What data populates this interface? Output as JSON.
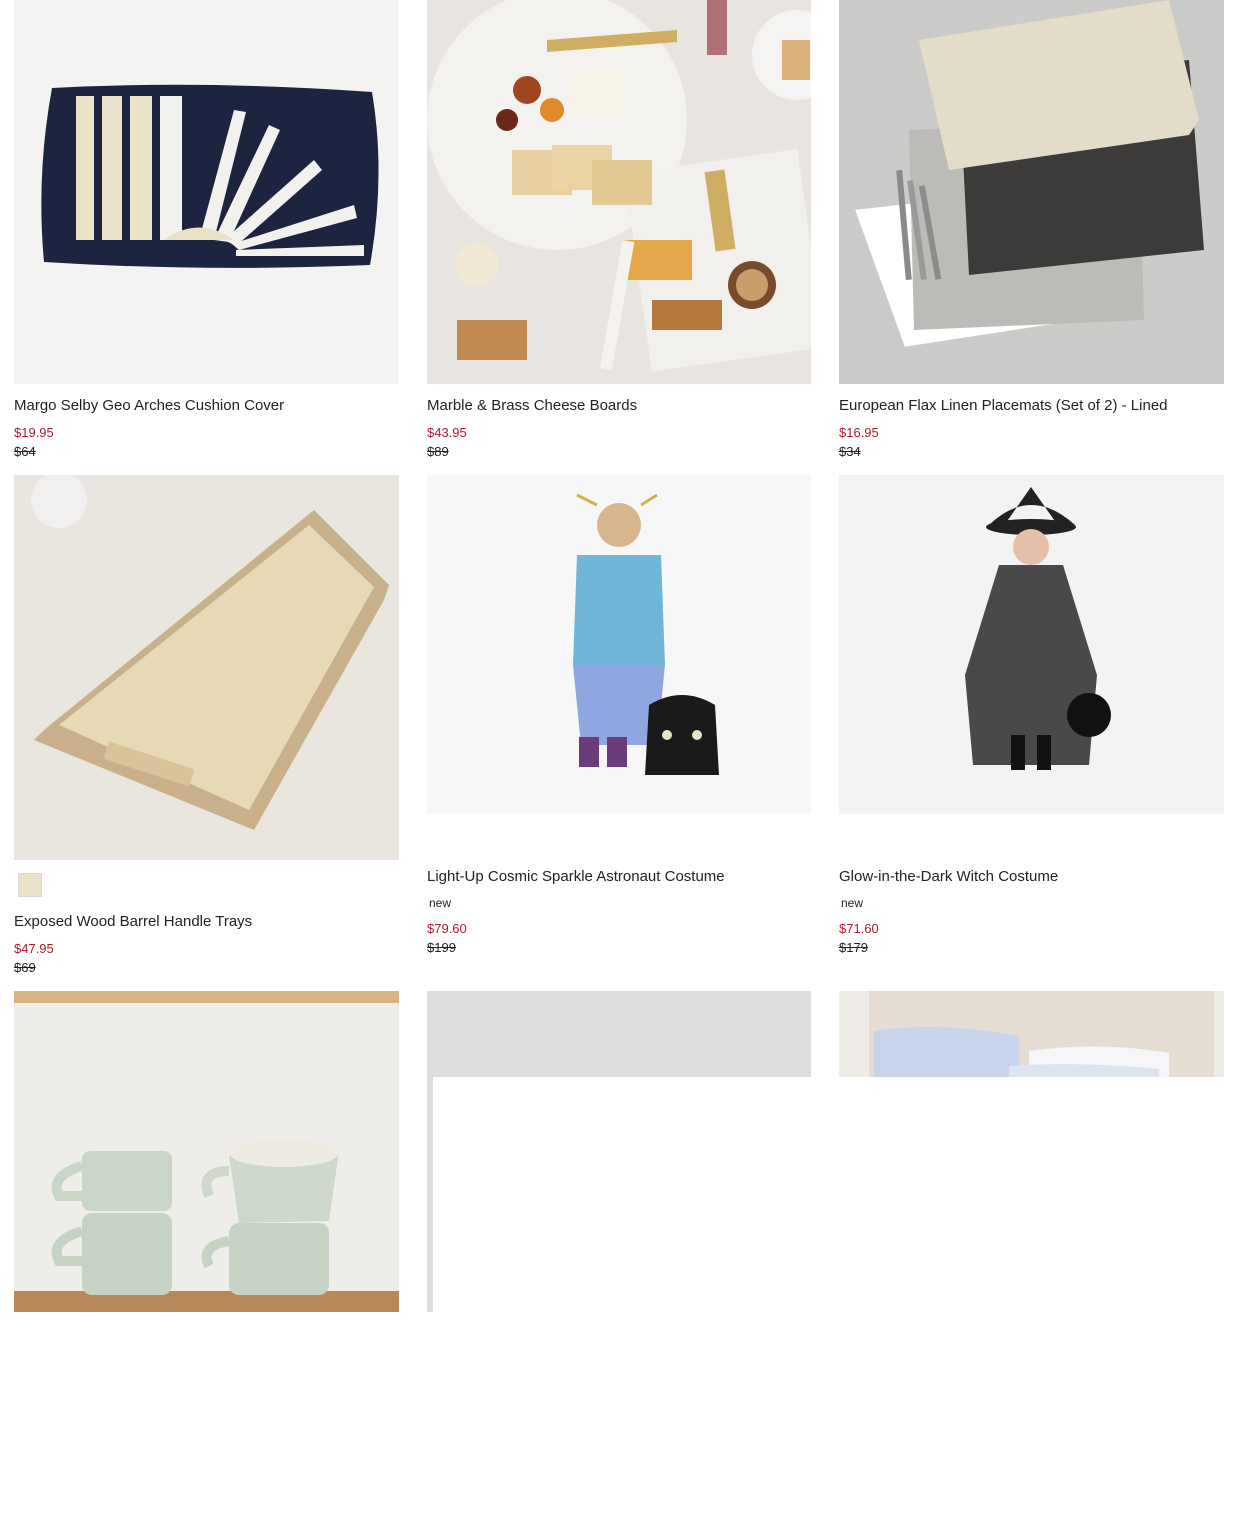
{
  "products": [
    {
      "name": "Margo Selby Geo Arches Cushion Cover",
      "sale_price": "$19.95",
      "original_price": "$64",
      "image": "navy-striped-lumbar-pillow"
    },
    {
      "name": "Marble & Brass Cheese Boards",
      "sale_price": "$43.95",
      "original_price": "$89",
      "image": "marble-cheese-boards-with-snacks"
    },
    {
      "name": "European Flax Linen Placemats (Set of 2) - Lined",
      "sale_price": "$16.95",
      "original_price": "$34",
      "image": "linen-placemats-with-cutlery"
    },
    {
      "name": "Exposed Wood Barrel Handle Trays",
      "sale_price": "$47.95",
      "original_price": "$69",
      "image": "light-wood-serving-tray",
      "swatch_color": "#ece2c9"
    },
    {
      "name": "Light-Up Cosmic Sparkle Astronaut Costume",
      "badge": "new",
      "sale_price": "$79.60",
      "original_price": "$199",
      "image": "child-in-astronaut-costume"
    },
    {
      "name": "Glow-in-the-Dark Witch Costume",
      "badge": "new",
      "sale_price": "$71.60",
      "original_price": "$179",
      "image": "child-in-witch-costume"
    },
    {
      "name": "",
      "image": "stacked-ceramic-mugs"
    },
    {
      "name": "",
      "image": "grey-wall-partial"
    },
    {
      "name": "",
      "image": "bed-with-pillows-partial"
    }
  ],
  "colors": {
    "sale": "#b5172f",
    "text": "#222222"
  }
}
